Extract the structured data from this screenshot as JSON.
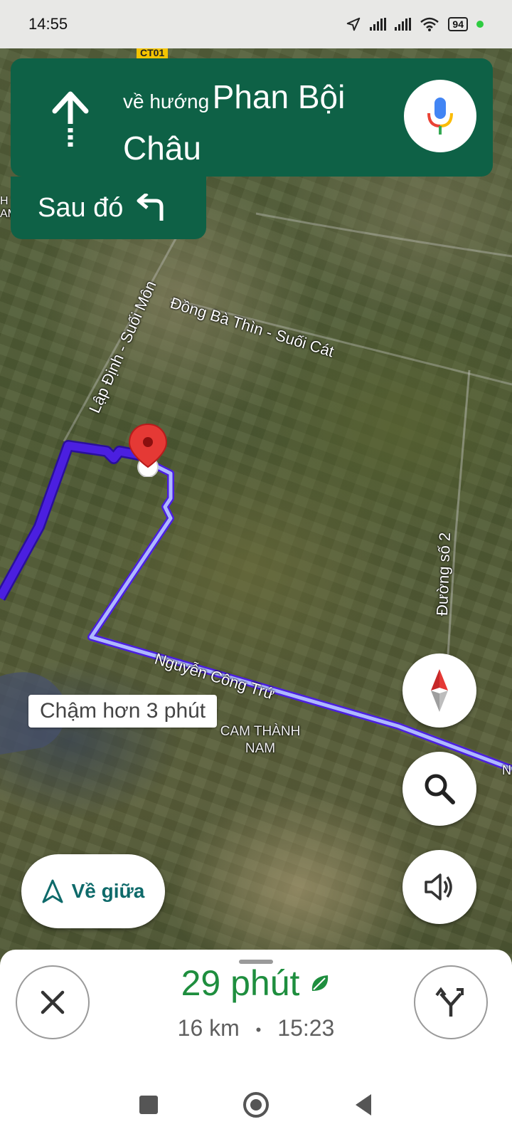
{
  "status_bar": {
    "time": "14:55",
    "battery": "94"
  },
  "map": {
    "route_code": "CT01",
    "road_labels": {
      "dong_ba_thin": "Đồng Bà Thìn - Suối Cát",
      "lap_dinh": "Lập Định - Suối Môn",
      "duong_so_2": "Đường số 2",
      "nguyen_cong_tru": "Nguyễn Công Trứ"
    },
    "place_label": "CAM THÀNH NAM",
    "left_edge_partial_label": "H AM",
    "right_edge_partial_label": "N",
    "alt_route_tag": "Chậm hơn 3 phút",
    "colors": {
      "primary_route": "#4b1fe0",
      "alt_route": "#aeb8ff",
      "pin": "#e53935"
    }
  },
  "nav_banner": {
    "direction_prefix": "về hướng",
    "direction_street": "Phan Bội Châu",
    "then_label": "Sau đó",
    "icons": {
      "main": "arrow-up-icon",
      "then": "turn-left-icon",
      "mic": "microphone-icon"
    },
    "color": "#0e6146"
  },
  "controls": {
    "recenter_label": "Về giữa",
    "compass": "compass-icon",
    "search": "search-icon",
    "sound": "volume-icon"
  },
  "trip": {
    "duration": "29 phút",
    "distance": "16 km",
    "separator": "•",
    "arrival": "15:23",
    "eco_icon": "leaf-icon",
    "duration_color": "#1e8e3e"
  },
  "system_nav": {
    "recent": "square-icon",
    "home": "circle-icon",
    "back": "triangle-back-icon"
  }
}
